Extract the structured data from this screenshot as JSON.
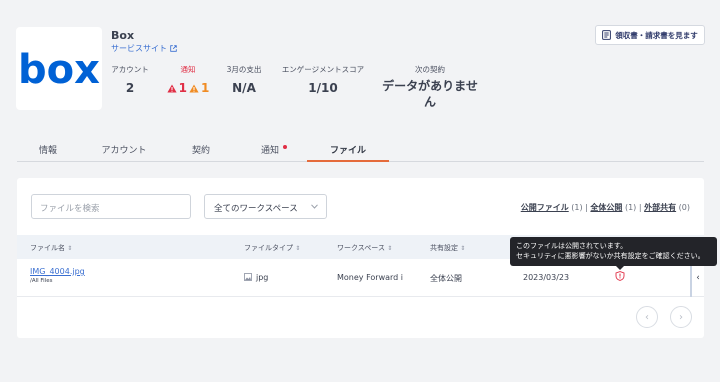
{
  "app": {
    "name": "Box",
    "site_link": "サービスサイト",
    "logo_text": "box"
  },
  "stats": {
    "account": {
      "label": "アカウント",
      "value": "2"
    },
    "alerts": {
      "label": "通知",
      "red_count": "1",
      "orange_count": "1"
    },
    "spend": {
      "label": "3月の支出",
      "value": "N/A"
    },
    "engagement": {
      "label": "エンゲージメントスコア",
      "value": "1/10"
    },
    "next_contract": {
      "label": "次の契約",
      "value_line1": "データがありませ",
      "value_line2": "ん"
    }
  },
  "receipt_button": "領収書・請求書を見ます",
  "tabs": [
    {
      "label": "情報"
    },
    {
      "label": "アカウント"
    },
    {
      "label": "契約"
    },
    {
      "label": "通知"
    },
    {
      "label": "ファイル"
    }
  ],
  "search": {
    "placeholder": "ファイルを検索"
  },
  "workspace_select": {
    "value": "全てのワークスペース"
  },
  "filters": {
    "public": {
      "label": "公開ファイル",
      "count": "(1)"
    },
    "all_public": {
      "label": "全体公開",
      "count": "(1)"
    },
    "external": {
      "label": "外部共有",
      "count": "(0)"
    }
  },
  "table": {
    "headers": {
      "filename": "ファイル名",
      "filetype": "ファイルタイプ",
      "workspace": "ワークスペース",
      "sharing": "共有設定"
    },
    "rows": [
      {
        "name": "IMG_4004.jpg",
        "path": "/All Files",
        "type": "jpg",
        "workspace": "Money Forward i",
        "sharing": "全体公開",
        "date": "2023/03/23"
      }
    ]
  },
  "tooltip": {
    "line1": "このファイルは公開されています。",
    "line2": "セキュリティに悪影響がないか共有設定をご確認ください。"
  },
  "colors": {
    "accent": "#e56b3b",
    "link": "#3a6fd1",
    "alert_red": "#e02e45",
    "alert_orange": "#f08b23",
    "box_blue": "#0061d5"
  },
  "icons": {
    "external_link": "external-link-icon",
    "receipt": "document-icon",
    "warning": "warning-triangle-icon",
    "shield": "shield-alert-icon"
  }
}
